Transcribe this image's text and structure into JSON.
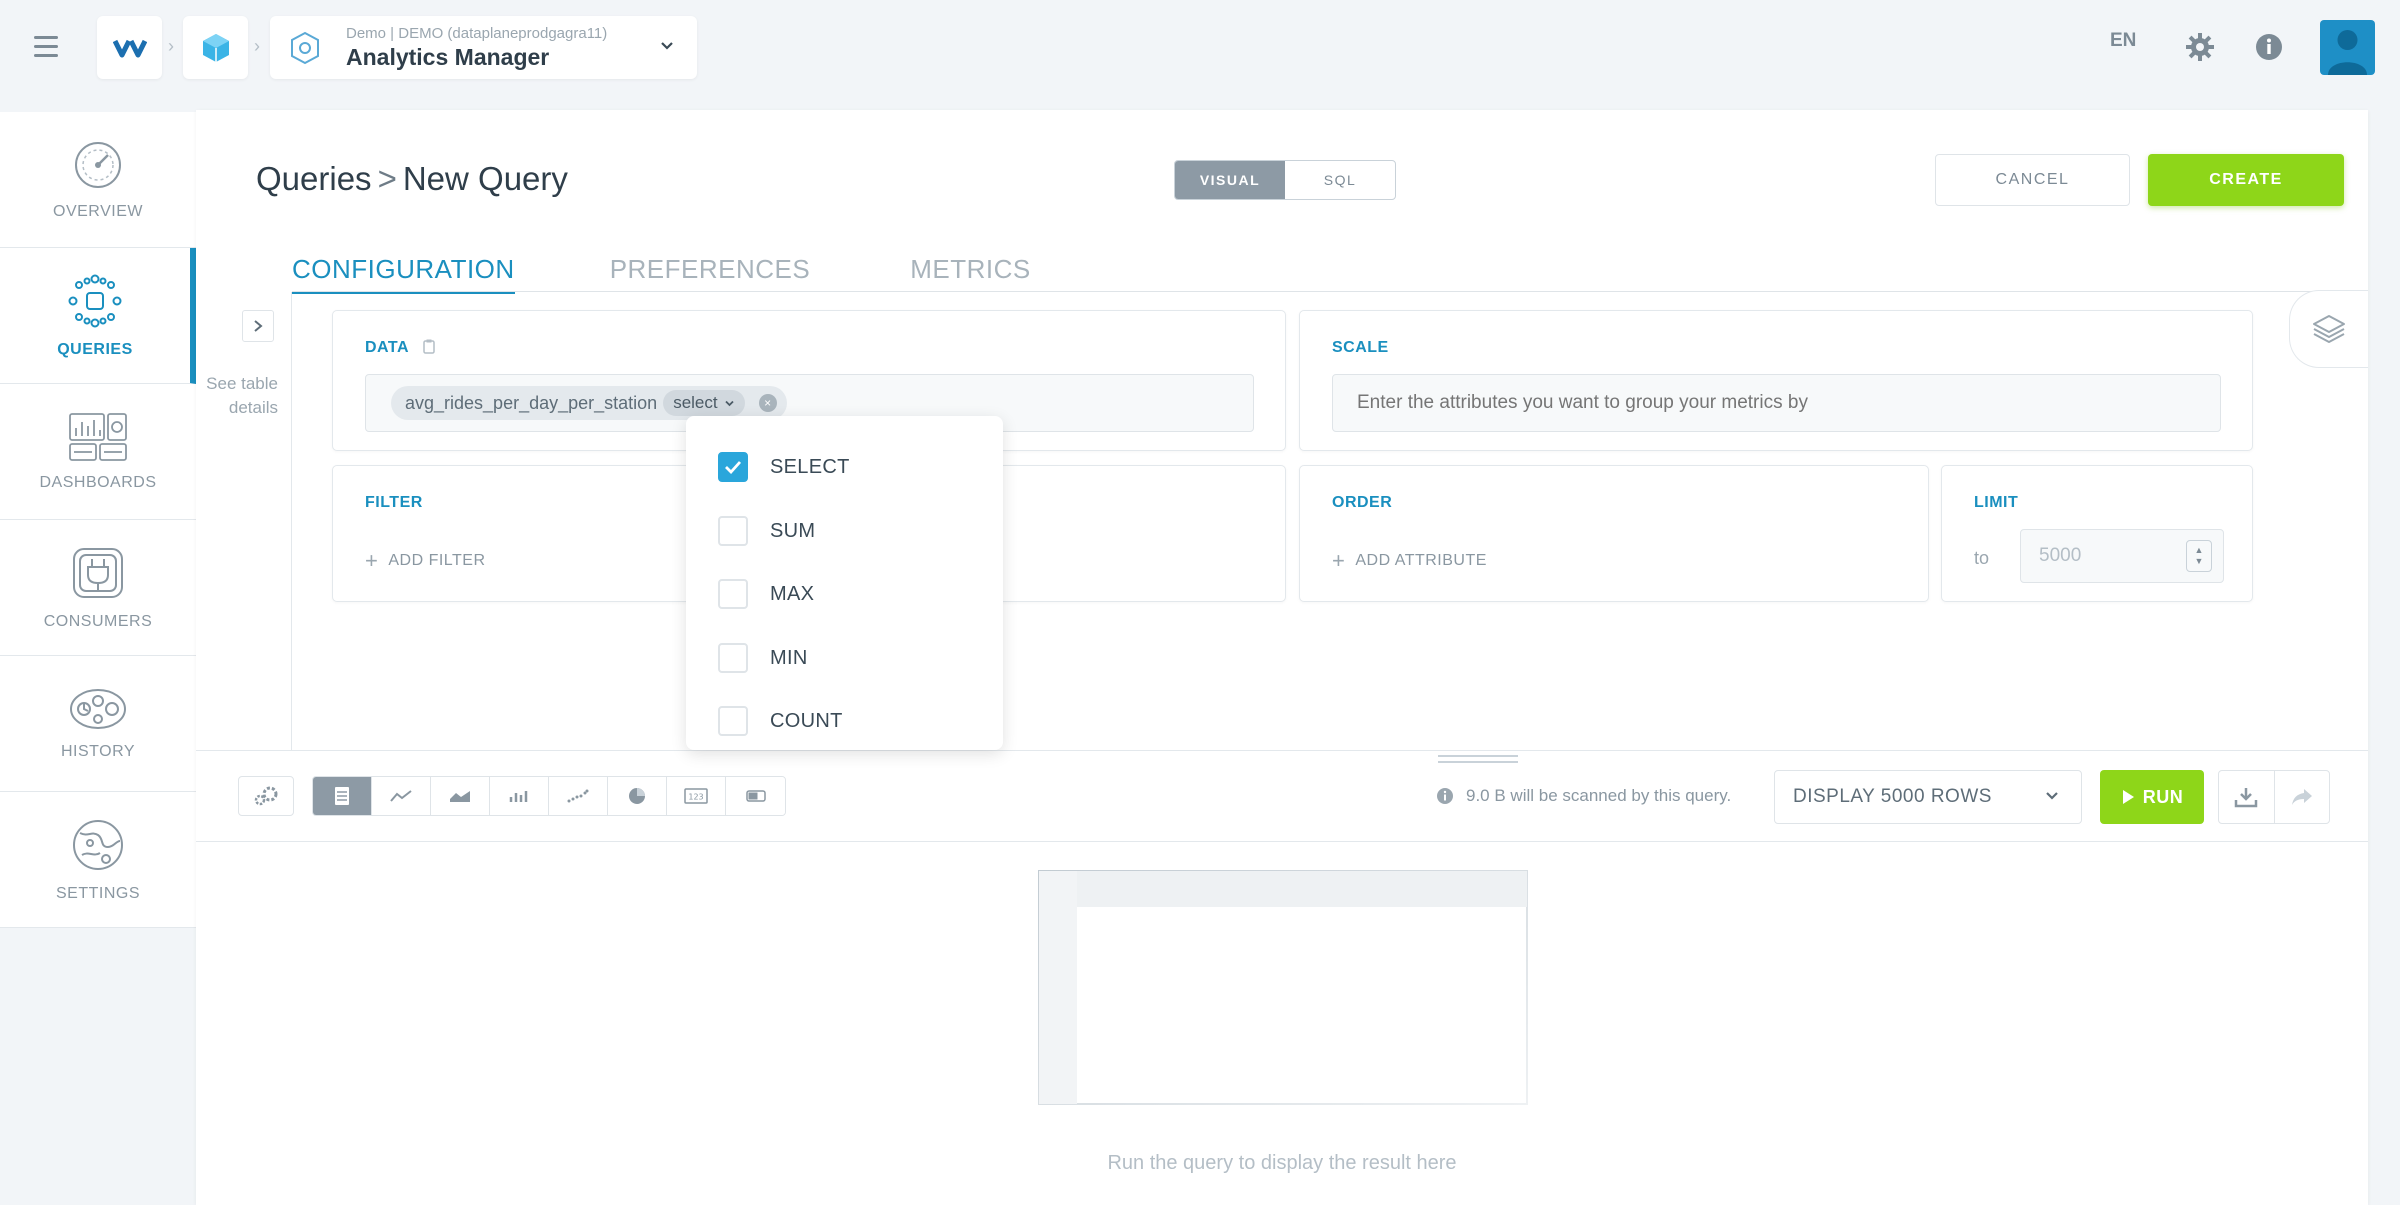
{
  "topbar": {
    "app_subtitle": "Demo | DEMO (dataplaneprodgagra11)",
    "app_title": "Analytics Manager",
    "language": "EN"
  },
  "sidenav": {
    "items": [
      {
        "label": "OVERVIEW",
        "icon": "gauge-icon"
      },
      {
        "label": "QUERIES",
        "icon": "network-icon",
        "active": true
      },
      {
        "label": "DASHBOARDS",
        "icon": "dashboard-icon"
      },
      {
        "label": "CONSUMERS",
        "icon": "plug-icon"
      },
      {
        "label": "HISTORY",
        "icon": "history-icon"
      },
      {
        "label": "SETTINGS",
        "icon": "globe-settings-icon"
      }
    ]
  },
  "header": {
    "breadcrumb_parent": "Queries",
    "breadcrumb_separator": ">",
    "breadcrumb_current": "New Query",
    "mode_visual": "VISUAL",
    "mode_sql": "SQL",
    "cancel_label": "CANCEL",
    "create_label": "CREATE"
  },
  "tabs": [
    {
      "label": "CONFIGURATION",
      "active": true
    },
    {
      "label": "PREFERENCES",
      "active": false
    },
    {
      "label": "METRICS",
      "active": false
    }
  ],
  "side_details": {
    "line1": "See table",
    "line2": "details"
  },
  "data_card": {
    "title": "DATA",
    "chip_label": "avg_rides_per_day_per_station",
    "chip_select": "select"
  },
  "scale_card": {
    "title": "SCALE",
    "placeholder": "Enter the attributes you want to group your metrics by"
  },
  "filter_card": {
    "title": "FILTER",
    "add_label": "ADD FILTER"
  },
  "order_card": {
    "title": "ORDER",
    "add_label": "ADD ATTRIBUTE"
  },
  "limit_card": {
    "title": "LIMIT",
    "to_label": "to",
    "value": "5000"
  },
  "aggregation_dropdown": {
    "options": [
      {
        "label": "SELECT",
        "checked": true
      },
      {
        "label": "SUM",
        "checked": false
      },
      {
        "label": "MAX",
        "checked": false
      },
      {
        "label": "MIN",
        "checked": false
      },
      {
        "label": "COUNT",
        "checked": false
      }
    ]
  },
  "toolbar": {
    "scan_info": "9.0 B will be scanned by this query.",
    "rows_select": "DISPLAY 5000 ROWS",
    "run_label": "RUN"
  },
  "result": {
    "message": "Run the query to display the result here"
  },
  "colors": {
    "accent": "#1a8fbf",
    "primary_green": "#8ed619",
    "checkbox_blue": "#2aa6db"
  }
}
